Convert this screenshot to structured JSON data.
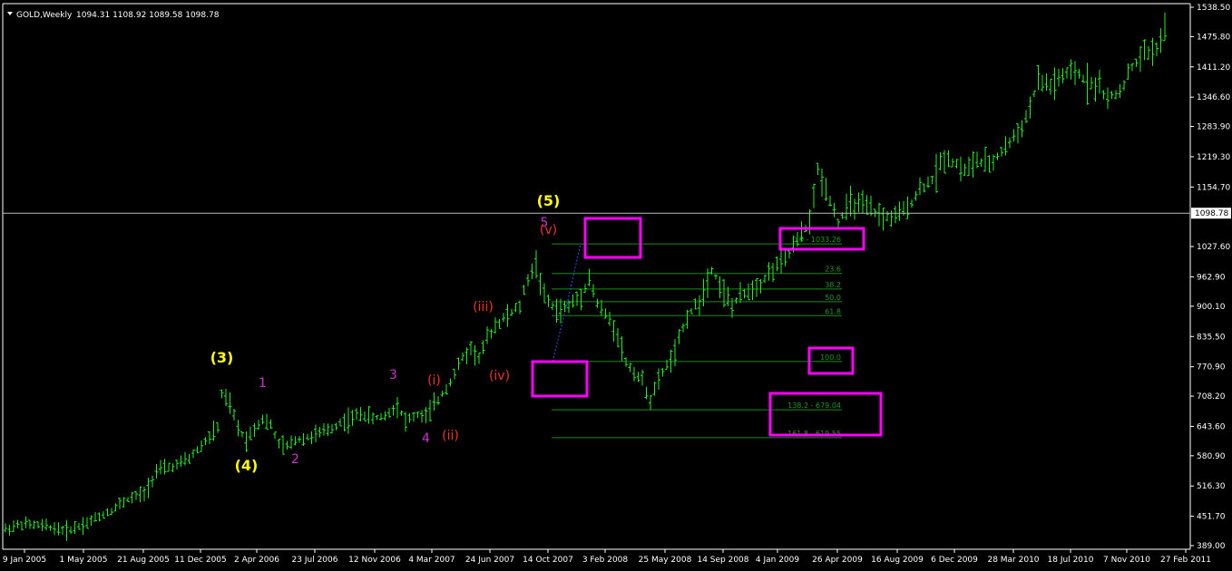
{
  "header": {
    "symbol_timeframe": "GOLD,Weekly",
    "ohlc": "1094.31 1108.92 1089.58 1098.78"
  },
  "colors": {
    "background": "#000000",
    "bars": "#22ee22",
    "axis": "#ffffff",
    "fib_lines": "#1a8c1a",
    "box": "#ff00ff",
    "wave_major": "#ffff00",
    "wave_minor": "#cc33cc",
    "wave_sub": "#ee3322",
    "trendline": "#3355ff",
    "price_line": "#bbbbbb"
  },
  "chart_data": {
    "type": "ohlc",
    "instrument": "GOLD",
    "timeframe": "Weekly",
    "current_price": 1098.78,
    "x_tick_labels": [
      "9 Jan 2005",
      "1 May 2005",
      "21 Aug 2005",
      "11 Dec 2005",
      "2 Apr 2006",
      "23 Jul 2006",
      "12 Nov 2006",
      "4 Mar 2007",
      "24 Jun 2007",
      "14 Oct 2007",
      "3 Feb 2008",
      "25 May 2008",
      "14 Sep 2008",
      "4 Jan 2009",
      "26 Apr 2009",
      "16 Aug 2009",
      "6 Dec 2009",
      "28 Mar 2010",
      "18 Jul 2010",
      "7 Nov 2010",
      "27 Feb 2011"
    ],
    "y_tick_labels": [
      "1538.50",
      "1475.80",
      "1411.20",
      "1346.60",
      "1283.90",
      "1219.30",
      "1154.70",
      "1027.60",
      "962.90",
      "900.10",
      "835.50",
      "770.90",
      "708.20",
      "643.60",
      "580.90",
      "516.30",
      "451.70",
      "389.00"
    ],
    "ylim": [
      389.0,
      1538.5
    ],
    "price_path": [
      [
        0,
        424
      ],
      [
        4,
        435
      ],
      [
        10,
        430
      ],
      [
        15,
        421
      ],
      [
        20,
        438
      ],
      [
        26,
        465
      ],
      [
        30,
        488
      ],
      [
        34,
        500
      ],
      [
        37,
        548
      ],
      [
        42,
        560
      ],
      [
        45,
        575
      ],
      [
        48,
        602
      ],
      [
        52,
        640
      ],
      [
        53,
        712
      ],
      [
        55,
        690
      ],
      [
        57,
        640
      ],
      [
        59,
        615
      ],
      [
        61,
        640
      ],
      [
        63,
        660
      ],
      [
        65,
        645
      ],
      [
        67,
        605
      ],
      [
        69,
        600
      ],
      [
        71,
        615
      ],
      [
        74,
        620
      ],
      [
        77,
        628
      ],
      [
        80,
        640
      ],
      [
        82,
        652
      ],
      [
        85,
        660
      ],
      [
        87,
        672
      ],
      [
        90,
        660
      ],
      [
        93,
        666
      ],
      [
        96,
        690
      ],
      [
        98,
        655
      ],
      [
        101,
        668
      ],
      [
        103,
        665
      ],
      [
        106,
        700
      ],
      [
        109,
        740
      ],
      [
        112,
        790
      ],
      [
        114,
        810
      ],
      [
        116,
        790
      ],
      [
        118,
        830
      ],
      [
        120,
        860
      ],
      [
        123,
        880
      ],
      [
        126,
        900
      ],
      [
        128,
        960
      ],
      [
        130,
        990
      ],
      [
        132,
        920
      ],
      [
        135,
        890
      ],
      [
        138,
        900
      ],
      [
        141,
        925
      ],
      [
        143,
        960
      ],
      [
        145,
        905
      ],
      [
        148,
        870
      ],
      [
        150,
        840
      ],
      [
        152,
        780
      ],
      [
        154,
        760
      ],
      [
        156,
        740
      ],
      [
        158,
        700
      ],
      [
        161,
        760
      ],
      [
        164,
        800
      ],
      [
        167,
        880
      ],
      [
        170,
        910
      ],
      [
        173,
        980
      ],
      [
        176,
        930
      ],
      [
        178,
        900
      ],
      [
        180,
        920
      ],
      [
        183,
        940
      ],
      [
        185,
        950
      ],
      [
        188,
        980
      ],
      [
        191,
        1000
      ],
      [
        194,
        1040
      ],
      [
        197,
        1080
      ],
      [
        199,
        1190
      ],
      [
        202,
        1130
      ],
      [
        204,
        1080
      ],
      [
        207,
        1120
      ],
      [
        211,
        1110
      ],
      [
        215,
        1090
      ],
      [
        218,
        1090
      ],
      [
        221,
        1110
      ],
      [
        224,
        1150
      ],
      [
        227,
        1170
      ],
      [
        230,
        1220
      ],
      [
        232,
        1210
      ],
      [
        235,
        1190
      ],
      [
        238,
        1210
      ],
      [
        241,
        1200
      ],
      [
        244,
        1230
      ],
      [
        247,
        1260
      ],
      [
        250,
        1300
      ],
      [
        253,
        1380
      ],
      [
        256,
        1370
      ],
      [
        259,
        1390
      ],
      [
        262,
        1400
      ],
      [
        265,
        1380
      ],
      [
        268,
        1370
      ],
      [
        270,
        1340
      ],
      [
        273,
        1360
      ],
      [
        276,
        1410
      ],
      [
        279,
        1440
      ],
      [
        282,
        1450
      ],
      [
        284,
        1490
      ]
    ],
    "fibonacci": {
      "levels": [
        {
          "label": "0.0 - 1033.26",
          "price": 1033.26
        },
        {
          "label": "23.6",
          "price": 970.1
        },
        {
          "label": "38.2",
          "price": 937.0
        },
        {
          "label": "50.0",
          "price": 909.8
        },
        {
          "label": "61.8",
          "price": 880.0
        },
        {
          "label": "100.0",
          "price": 782.0
        },
        {
          "label": "138.2 - 679.04",
          "price": 679.04
        },
        {
          "label": "161.8 - 619.55",
          "price": 619.55
        }
      ]
    },
    "wave_labels": [
      {
        "text": "(3)",
        "week": 53,
        "price": 780,
        "kind": "major"
      },
      {
        "text": "(4)",
        "week": 59,
        "price": 550,
        "kind": "major"
      },
      {
        "text": "(5)",
        "week": 133,
        "price": 1115,
        "kind": "major"
      },
      {
        "text": "1",
        "week": 63,
        "price": 728,
        "kind": "minor"
      },
      {
        "text": "2",
        "week": 71,
        "price": 565,
        "kind": "minor"
      },
      {
        "text": "3",
        "week": 95,
        "price": 745,
        "kind": "minor"
      },
      {
        "text": "4",
        "week": 103,
        "price": 610,
        "kind": "minor"
      },
      {
        "text": "5",
        "week": 132,
        "price": 1070,
        "kind": "minor"
      },
      {
        "text": "(i)",
        "week": 105,
        "price": 733,
        "kind": "sub"
      },
      {
        "text": "(ii)",
        "week": 109,
        "price": 615,
        "kind": "sub"
      },
      {
        "text": "(iii)",
        "week": 117,
        "price": 890,
        "kind": "sub"
      },
      {
        "text": "(iv)",
        "week": 121,
        "price": 743,
        "kind": "sub"
      },
      {
        "text": "(v)",
        "week": 133,
        "price": 1055,
        "kind": "sub"
      }
    ]
  }
}
